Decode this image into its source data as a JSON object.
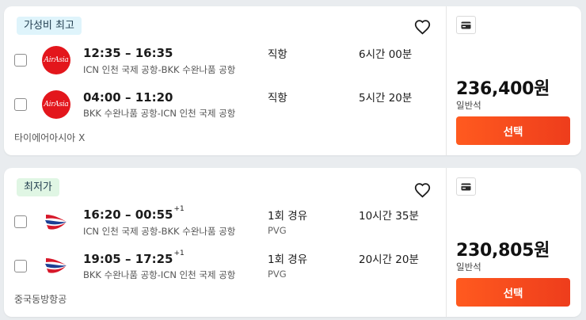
{
  "results": [
    {
      "badge": "가성비 최고",
      "airline": "타이에어아시아 X",
      "logo_text": "AirAsia",
      "legs": [
        {
          "times": "12:35 – 16:35",
          "day_offset": "",
          "route": "ICN 인천 국제 공항-BKK 수완나품 공항",
          "stops": "직항",
          "via": "",
          "duration": "6시간 00분"
        },
        {
          "times": "04:00 – 11:20",
          "day_offset": "",
          "route": "BKK 수완나품 공항-ICN 인천 국제 공항",
          "stops": "직항",
          "via": "",
          "duration": "5시간 20분"
        }
      ],
      "price": "236,400원",
      "cabin": "일반석",
      "select_label": "선택"
    },
    {
      "badge": "최저가",
      "airline": "중국동방항공",
      "logo_text": "",
      "legs": [
        {
          "times": "16:20 – 00:55",
          "day_offset": "+1",
          "route": "ICN 인천 국제 공항-BKK 수완나품 공항",
          "stops": "1회 경유",
          "via": "PVG",
          "duration": "10시간 35분"
        },
        {
          "times": "19:05 – 17:25",
          "day_offset": "+1",
          "route": "BKK 수완나품 공항-ICN 인천 국제 공항",
          "stops": "1회 경유",
          "via": "PVG",
          "duration": "20시간 20분"
        }
      ],
      "price": "230,805원",
      "cabin": "일반석",
      "select_label": "선택"
    }
  ],
  "icons": {
    "favorite": "heart-outline-icon",
    "baggage": "baggage-card-icon"
  },
  "colors": {
    "select_button": "#f44a1e",
    "badge_best_value": "#dff4fb",
    "badge_cheapest": "#e0f6e4",
    "airasia_red": "#e3161c",
    "china_eastern_red": "#d7182a",
    "china_eastern_blue": "#1c3f94"
  }
}
